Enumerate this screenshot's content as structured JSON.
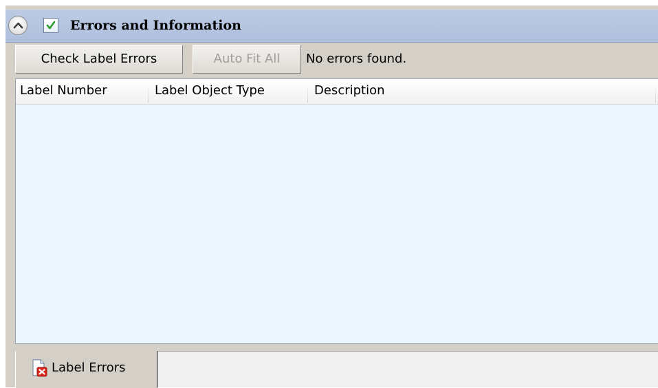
{
  "header": {
    "title": "Errors and Information",
    "collapse_icon": "chevron-up-icon",
    "enabled_checked": true
  },
  "toolbar": {
    "check_label_errors": "Check Label Errors",
    "auto_fit_all": "Auto Fit All",
    "status": "No errors found."
  },
  "grid": {
    "columns": [
      "Label Number",
      "Label Object Type",
      "Description"
    ],
    "rows": []
  },
  "tabs": [
    {
      "label": "Label Errors",
      "icon": "label-error-icon",
      "selected": true
    }
  ],
  "colors": {
    "header_bar": "#aebfdd",
    "panel_bg": "#d4d0c8",
    "grid_bg": "#eef6fd",
    "check_green": "#2e9b2e",
    "error_red": "#d9261c"
  }
}
